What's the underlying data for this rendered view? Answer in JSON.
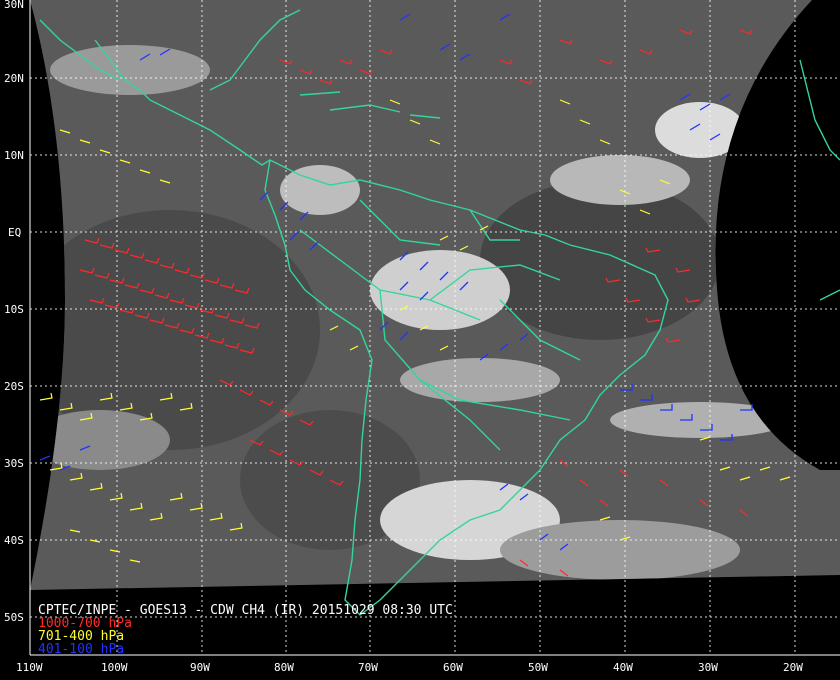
{
  "caption": {
    "title": "CPTEC/INPE - GOES13 - CDW CH4 (IR) 20151029 08:30 UTC",
    "legend": [
      {
        "label": "1000-700 hPa",
        "color": "#ff2a2a"
      },
      {
        "label": "701-400 hPa",
        "color": "#ffff33"
      },
      {
        "label": "401-100 hPa",
        "color": "#2233ff"
      }
    ]
  },
  "latitude_labels": [
    "30N",
    "20N",
    "10N",
    "EQ",
    "10S",
    "20S",
    "30S",
    "40S",
    "50S"
  ],
  "longitude_labels": [
    "110W",
    "100W",
    "90W",
    "80W",
    "70W",
    "60W",
    "50W",
    "40W",
    "30W",
    "20W"
  ],
  "colors": {
    "background": "#000000",
    "coastline": "#33d69a",
    "grid": "#ffffff",
    "low_level_wind": "#ff2a2a",
    "mid_level_wind": "#ffff33",
    "high_level_wind": "#2233ff"
  }
}
